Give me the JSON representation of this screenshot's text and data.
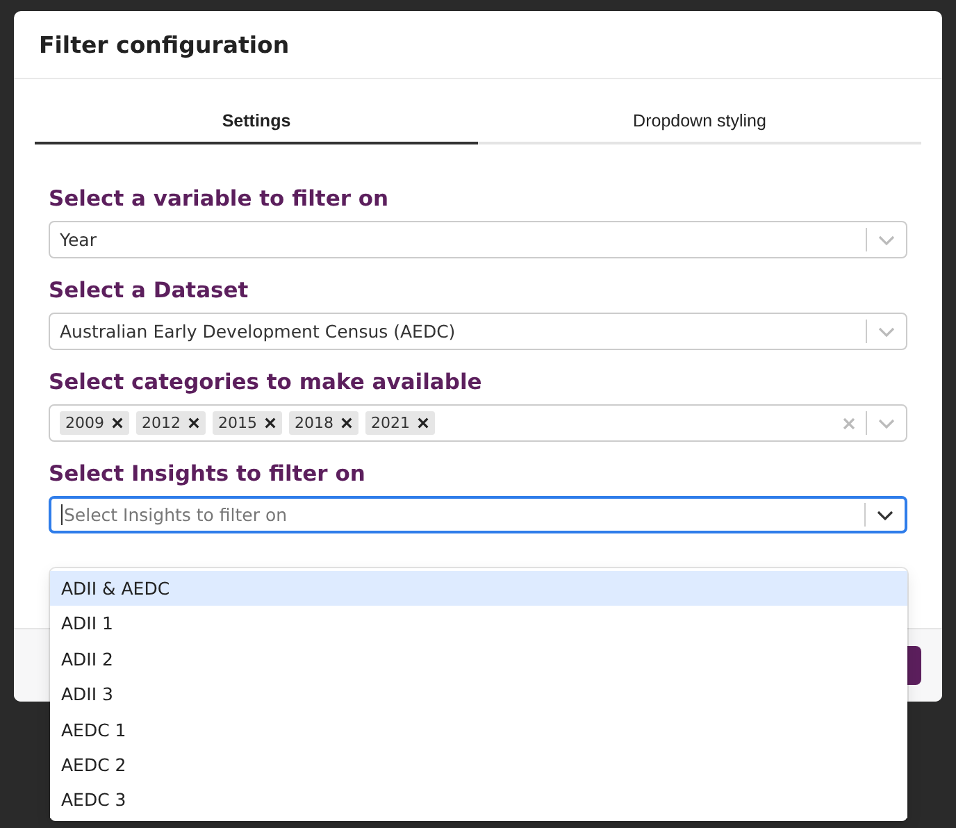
{
  "dialog": {
    "title": "Filter configuration"
  },
  "tabs": [
    {
      "label": "Settings",
      "selected": true
    },
    {
      "label": "Dropdown styling",
      "selected": false
    }
  ],
  "fields": [
    {
      "label": "Select a variable to filter on",
      "kind": "single",
      "value": "Year",
      "focused": false
    },
    {
      "label": "Select a Dataset",
      "kind": "single",
      "value": "Australian Early Development Census (AEDC)",
      "focused": false
    },
    {
      "label": "Select categories to make available",
      "kind": "multi",
      "tags": [
        "2009",
        "2012",
        "2015",
        "2018",
        "2021"
      ],
      "focused": false
    },
    {
      "label": "Select Insights to filter on",
      "kind": "single",
      "placeholder": "Select Insights to filter on",
      "focused": true,
      "menu": [
        {
          "label": "ADII & AEDC",
          "highlighted": true
        },
        {
          "label": "ADII 1",
          "highlighted": false
        },
        {
          "label": "ADII 2",
          "highlighted": false
        },
        {
          "label": "ADII 3",
          "highlighted": false
        },
        {
          "label": "AEDC 1",
          "highlighted": false
        },
        {
          "label": "AEDC 2",
          "highlighted": false
        },
        {
          "label": "AEDC 3",
          "highlighted": false
        }
      ]
    }
  ]
}
